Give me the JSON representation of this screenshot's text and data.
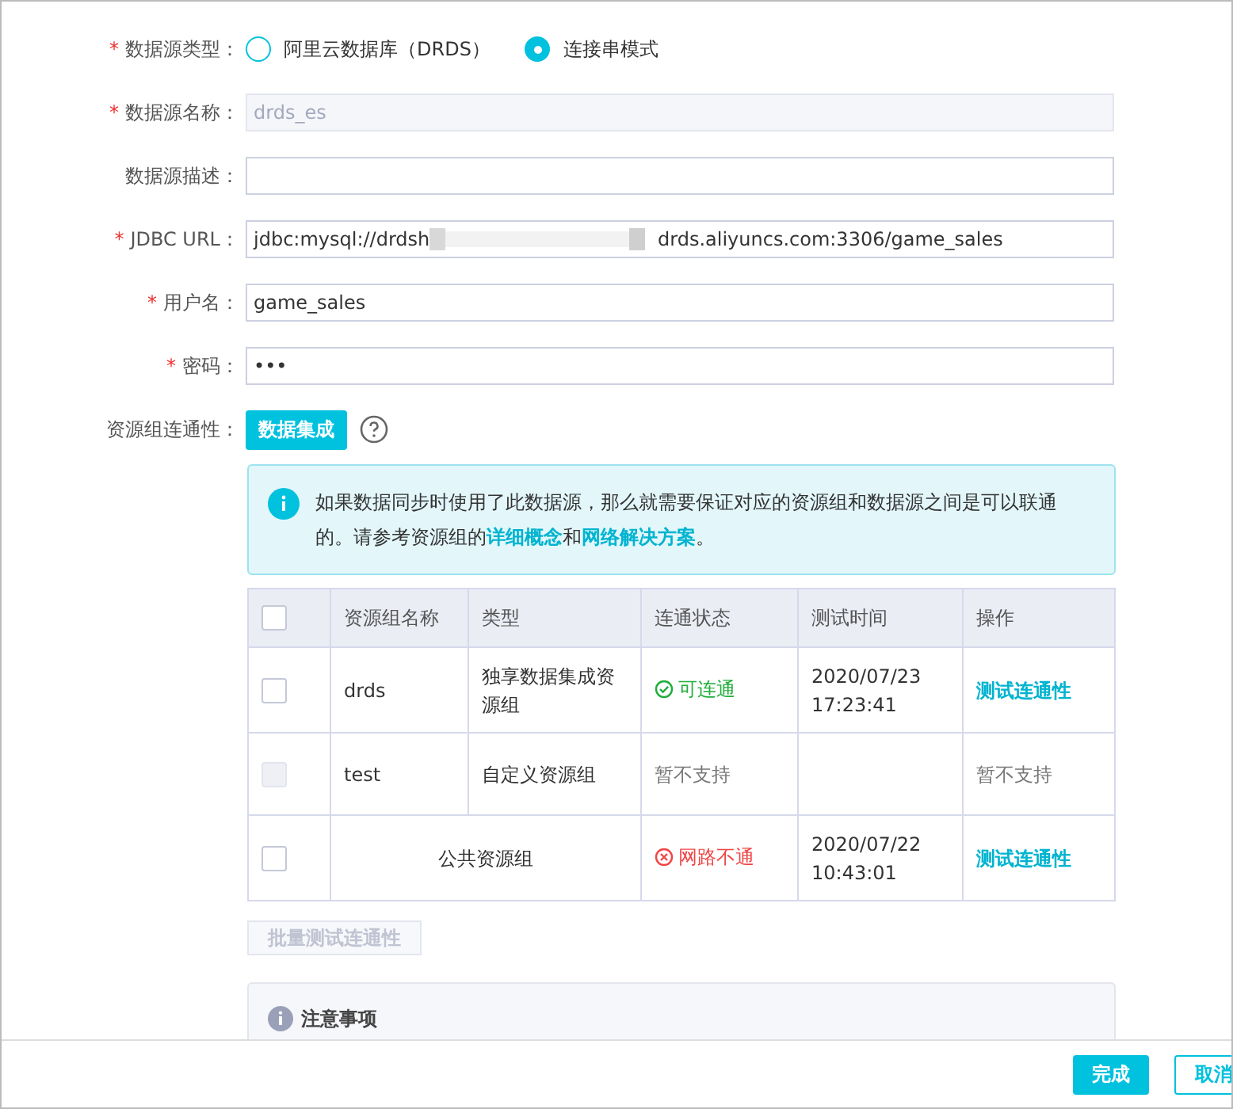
{
  "form": {
    "source_type": {
      "label": "数据源类型：",
      "required_mark": "*",
      "options": [
        {
          "label": "阿里云数据库（DRDS）",
          "selected": false
        },
        {
          "label": "连接串模式",
          "selected": true
        }
      ]
    },
    "fields": [
      {
        "label": "数据源名称：",
        "required_mark": "*",
        "value": "drds_es",
        "disabled": true
      },
      {
        "label": "数据源描述：",
        "disabled": false
      },
      {
        "label": "JDBC URL：",
        "required_mark": "*",
        "value": "jdbc:mysql://drdsh",
        "value_after_redaction": "drds.aliyuncs.com:3306/game_sales",
        "disabled": false
      },
      {
        "label": "用户名：",
        "required_mark": "*",
        "value": "game_sales",
        "disabled": false
      },
      {
        "label": "密码：",
        "required_mark": "*",
        "value": "•••",
        "disabled": false
      }
    ]
  },
  "connectivity": {
    "label": "资源组连通性：",
    "tag": "数据集成",
    "info": {
      "text": "如果数据同步时使用了此数据源，那么就需要保证对应的资源组和数据源之间是可以联通的。请参考资源组的",
      "link1": "详细概念",
      "middle": "和",
      "link2": "网络解决方案",
      "end": "。"
    },
    "table": {
      "select_all_checked": false,
      "columns": [
        "资源组名称",
        "类型",
        "连通状态",
        "测试时间",
        "操作"
      ],
      "rows": [
        {
          "name": "drds",
          "type": "独享数据集成资源组",
          "status": {
            "text": "可连通",
            "kind": "ok"
          },
          "time": "2020/07/23 17:23:41",
          "action": {
            "text": "测试连通性",
            "kind": "link"
          },
          "checked": false,
          "disabled": false
        },
        {
          "name": "test",
          "type": "自定义资源组",
          "status": {
            "text": "暂不支持",
            "kind": "none"
          },
          "action": {
            "text": "暂不支持",
            "kind": "text"
          },
          "checked": false,
          "disabled": true
        },
        {
          "merged_name_type": "公共资源组",
          "status": {
            "text": "网路不通",
            "kind": "fail"
          },
          "time": "2020/07/22 10:43:01",
          "action": {
            "text": "测试连通性",
            "kind": "link"
          },
          "checked": false,
          "disabled": false
        }
      ]
    },
    "batch_button": {
      "label": "批量测试连通性",
      "disabled": true
    },
    "notes": {
      "title": "注意事项"
    }
  },
  "footer": {
    "buttons": [
      {
        "label": "完成",
        "primary": true
      },
      {
        "label": "取消",
        "primary": false
      }
    ]
  }
}
